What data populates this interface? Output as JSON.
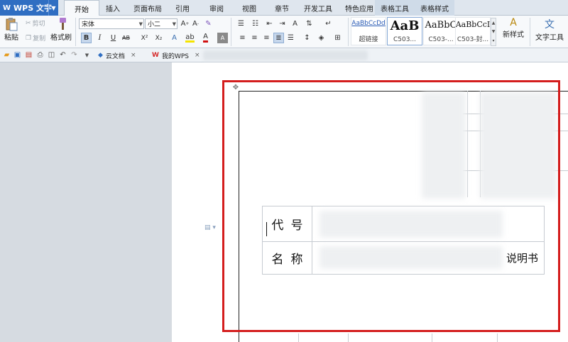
{
  "app": {
    "name": "WPS 文字",
    "logo": "W"
  },
  "menu": {
    "tabs": [
      {
        "label": "开始",
        "active": true
      },
      {
        "label": "插入"
      },
      {
        "label": "页面布局"
      },
      {
        "label": "引用"
      },
      {
        "label": "审阅"
      },
      {
        "label": "视图"
      },
      {
        "label": "章节"
      },
      {
        "label": "开发工具"
      },
      {
        "label": "特色应用"
      },
      {
        "label": "表格工具",
        "context": true
      },
      {
        "label": "表格样式",
        "context": true
      }
    ]
  },
  "ribbon": {
    "paste": "粘贴",
    "cut": "剪切",
    "copy": "复制",
    "format_painter": "格式刷",
    "font_name": "宋体",
    "font_size": "小二",
    "format_buttons": {
      "bold": "B",
      "italic": "I",
      "underline": "U",
      "strike": "AB",
      "superscript": "X²",
      "subscript": "X₂"
    },
    "styles": [
      {
        "preview": "AaBbCcDd",
        "name": "超链接"
      },
      {
        "preview": "AaB",
        "name": "C503..."
      },
      {
        "preview": "AaBbC",
        "name": "C503-..."
      },
      {
        "preview": "AaBbCcI",
        "name": "C503-封..."
      }
    ],
    "new_style": "新样式",
    "text_tools": "文字工具"
  },
  "doc_tabs": [
    {
      "label": "云文档"
    },
    {
      "label": "我的WPS"
    }
  ],
  "document": {
    "rows": [
      {
        "label": "代号",
        "value_suffix": ""
      },
      {
        "label": "名称",
        "value_suffix": "说明书"
      }
    ]
  },
  "colors": {
    "accent": "#2f6ec2",
    "highlight_border": "#d41d1d",
    "wps_red": "#d62b2b"
  }
}
